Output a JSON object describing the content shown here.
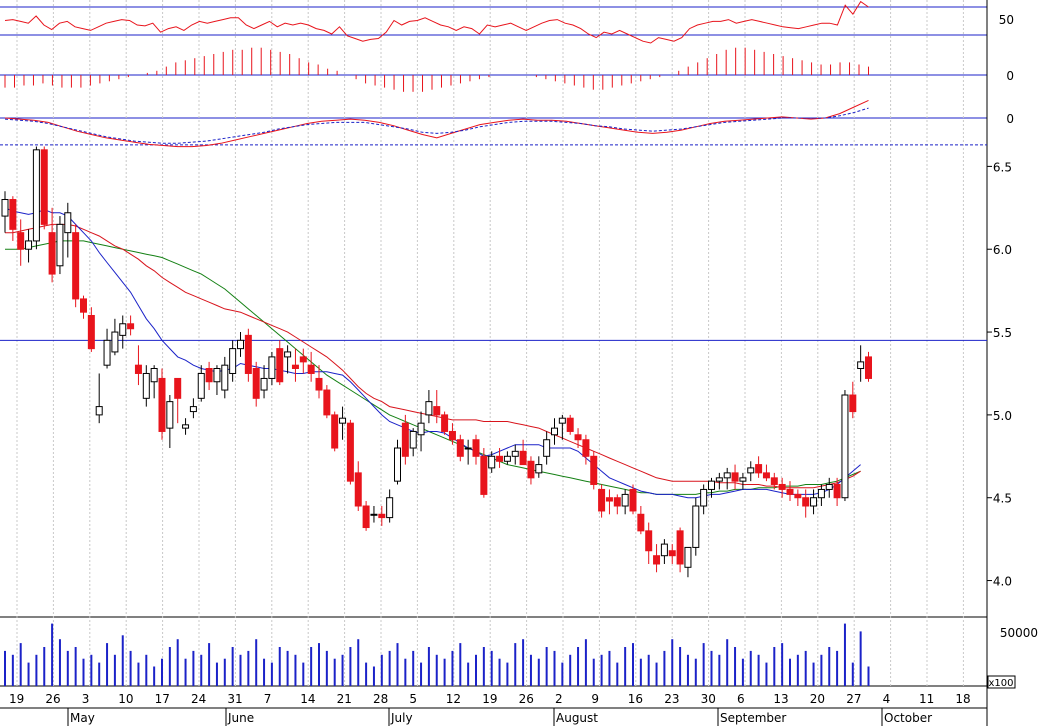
{
  "chart_data": {
    "type": "candlestick",
    "panels": {
      "rsi": {
        "ticks": [
          "50"
        ]
      },
      "histogram": {
        "ticks": [
          "0"
        ]
      },
      "macd": {
        "ticks": [
          "0"
        ]
      },
      "price": {
        "ylim": [
          3.78,
          6.78
        ],
        "ticks": [
          "6.5",
          "6.0",
          "5.5",
          "5.0",
          "4.5",
          "4.0"
        ],
        "dashed_level": 6.63,
        "solid_level": 5.45
      },
      "volume": {
        "ticks": [
          "50000"
        ],
        "multiplier": "x100"
      }
    },
    "x_day_labels": [
      "19",
      "26",
      "3",
      "10",
      "17",
      "24",
      "31",
      "7",
      "14",
      "21",
      "28",
      "5",
      "12",
      "19",
      "26",
      "2",
      "9",
      "16",
      "23",
      "30",
      "6",
      "13",
      "20",
      "27",
      "4",
      "11",
      "18"
    ],
    "x_month_labels": [
      "May",
      "June",
      "July",
      "August",
      "September",
      "October"
    ],
    "colors": {
      "up": "#ffffff",
      "down": "#e8141c",
      "ma_short": "#1b22c8",
      "ma_mid": "#d8141c",
      "ma_long": "#148014",
      "volume": "#1b22c8"
    },
    "ohlc": [
      [
        6.2,
        6.35,
        6.1,
        6.3
      ],
      [
        6.3,
        6.32,
        6.05,
        6.12
      ],
      [
        6.1,
        6.18,
        5.9,
        6.0
      ],
      [
        6.0,
        6.12,
        5.92,
        6.05
      ],
      [
        6.05,
        6.62,
        6.0,
        6.6
      ],
      [
        6.6,
        6.62,
        6.12,
        6.15
      ],
      [
        6.1,
        6.25,
        5.8,
        5.85
      ],
      [
        5.9,
        6.2,
        5.85,
        6.15
      ],
      [
        6.1,
        6.28,
        5.95,
        6.22
      ],
      [
        6.1,
        6.15,
        5.65,
        5.7
      ],
      [
        5.7,
        5.72,
        5.58,
        5.62
      ],
      [
        5.6,
        5.65,
        5.38,
        5.4
      ],
      [
        5.0,
        5.25,
        4.95,
        5.05
      ],
      [
        5.3,
        5.52,
        5.28,
        5.45
      ],
      [
        5.38,
        5.58,
        5.36,
        5.5
      ],
      [
        5.48,
        5.6,
        5.4,
        5.55
      ],
      [
        5.55,
        5.6,
        5.48,
        5.52
      ],
      [
        5.3,
        5.42,
        5.18,
        5.25
      ],
      [
        5.1,
        5.3,
        5.05,
        5.25
      ],
      [
        5.2,
        5.3,
        5.1,
        5.28
      ],
      [
        5.22,
        5.28,
        4.85,
        4.9
      ],
      [
        4.92,
        5.12,
        4.8,
        5.08
      ],
      [
        5.22,
        5.2,
        4.95,
        5.1
      ],
      [
        4.92,
        4.98,
        4.88,
        4.94
      ],
      [
        5.02,
        5.1,
        4.98,
        5.05
      ],
      [
        5.1,
        5.3,
        5.08,
        5.25
      ],
      [
        5.28,
        5.32,
        5.15,
        5.2
      ],
      [
        5.2,
        5.3,
        5.12,
        5.28
      ],
      [
        5.15,
        5.35,
        5.1,
        5.3
      ],
      [
        5.25,
        5.45,
        5.2,
        5.4
      ],
      [
        5.4,
        5.5,
        5.35,
        5.45
      ],
      [
        5.48,
        5.52,
        5.2,
        5.25
      ],
      [
        5.28,
        5.32,
        5.05,
        5.1
      ],
      [
        5.15,
        5.3,
        5.1,
        5.22
      ],
      [
        5.22,
        5.38,
        5.18,
        5.35
      ],
      [
        5.4,
        5.45,
        5.18,
        5.2
      ],
      [
        5.35,
        5.42,
        5.25,
        5.38
      ],
      [
        5.3,
        5.4,
        5.2,
        5.28
      ],
      [
        5.35,
        5.4,
        5.25,
        5.32
      ],
      [
        5.3,
        5.38,
        5.2,
        5.25
      ],
      [
        5.22,
        5.3,
        5.1,
        5.15
      ],
      [
        5.15,
        5.18,
        4.98,
        5.0
      ],
      [
        5.0,
        5.02,
        4.78,
        4.8
      ],
      [
        4.95,
        5.05,
        4.85,
        4.98
      ],
      [
        4.95,
        4.97,
        4.58,
        4.6
      ],
      [
        4.65,
        4.72,
        4.42,
        4.45
      ],
      [
        4.45,
        4.48,
        4.3,
        4.32
      ],
      [
        4.4,
        4.45,
        4.35,
        4.4
      ],
      [
        4.4,
        4.45,
        4.33,
        4.38
      ],
      [
        4.38,
        4.55,
        4.35,
        4.5
      ],
      [
        4.6,
        4.85,
        4.58,
        4.8
      ],
      [
        4.95,
        5.0,
        4.7,
        4.75
      ],
      [
        4.8,
        4.92,
        4.75,
        4.9
      ],
      [
        4.88,
        5.02,
        4.78,
        4.95
      ],
      [
        5.0,
        5.15,
        4.95,
        5.08
      ],
      [
        5.05,
        5.15,
        4.95,
        5.0
      ],
      [
        5.0,
        5.02,
        4.88,
        4.9
      ],
      [
        4.9,
        4.95,
        4.82,
        4.85
      ],
      [
        4.85,
        4.88,
        4.72,
        4.75
      ],
      [
        4.8,
        4.85,
        4.7,
        4.8
      ],
      [
        4.85,
        4.88,
        4.7,
        4.75
      ],
      [
        4.75,
        4.8,
        4.5,
        4.52
      ],
      [
        4.68,
        4.78,
        4.65,
        4.75
      ],
      [
        4.75,
        4.8,
        4.68,
        4.72
      ],
      [
        4.72,
        4.78,
        4.7,
        4.75
      ],
      [
        4.75,
        4.82,
        4.7,
        4.78
      ],
      [
        4.78,
        4.85,
        4.72,
        4.7
      ],
      [
        4.72,
        4.75,
        4.58,
        4.62
      ],
      [
        4.65,
        4.75,
        4.62,
        4.7
      ],
      [
        4.75,
        4.9,
        4.7,
        4.85
      ],
      [
        4.88,
        4.98,
        4.82,
        4.92
      ],
      [
        4.95,
        5.0,
        4.85,
        4.98
      ],
      [
        4.98,
        5.0,
        4.88,
        4.9
      ],
      [
        4.88,
        4.92,
        4.8,
        4.85
      ],
      [
        4.85,
        4.88,
        4.7,
        4.75
      ],
      [
        4.75,
        4.78,
        4.55,
        4.58
      ],
      [
        4.55,
        4.58,
        4.38,
        4.42
      ],
      [
        4.5,
        4.55,
        4.4,
        4.48
      ],
      [
        4.5,
        4.52,
        4.4,
        4.45
      ],
      [
        4.45,
        4.55,
        4.4,
        4.52
      ],
      [
        4.55,
        4.58,
        4.4,
        4.42
      ],
      [
        4.4,
        4.45,
        4.28,
        4.3
      ],
      [
        4.3,
        4.35,
        4.1,
        4.18
      ],
      [
        4.15,
        4.22,
        4.05,
        4.1
      ],
      [
        4.15,
        4.25,
        4.1,
        4.22
      ],
      [
        4.18,
        4.22,
        4.1,
        4.15
      ],
      [
        4.3,
        4.32,
        4.05,
        4.1
      ],
      [
        4.08,
        4.2,
        4.02,
        4.2
      ],
      [
        4.2,
        4.5,
        4.15,
        4.45
      ],
      [
        4.45,
        4.58,
        4.4,
        4.55
      ],
      [
        4.55,
        4.62,
        4.5,
        4.6
      ],
      [
        4.6,
        4.65,
        4.55,
        4.62
      ],
      [
        4.62,
        4.68,
        4.55,
        4.65
      ],
      [
        4.65,
        4.7,
        4.55,
        4.6
      ],
      [
        4.6,
        4.65,
        4.55,
        4.62
      ],
      [
        4.65,
        4.72,
        4.6,
        4.68
      ],
      [
        4.7,
        4.75,
        4.62,
        4.65
      ],
      [
        4.65,
        4.7,
        4.6,
        4.62
      ],
      [
        4.62,
        4.65,
        4.55,
        4.58
      ],
      [
        4.58,
        4.62,
        4.5,
        4.55
      ],
      [
        4.55,
        4.6,
        4.48,
        4.52
      ],
      [
        4.52,
        4.55,
        4.45,
        4.5
      ],
      [
        4.5,
        4.55,
        4.38,
        4.45
      ],
      [
        4.45,
        4.55,
        4.4,
        4.5
      ],
      [
        4.5,
        4.58,
        4.45,
        4.55
      ],
      [
        4.55,
        4.62,
        4.5,
        4.58
      ],
      [
        4.58,
        4.62,
        4.45,
        4.5
      ],
      [
        4.5,
        5.15,
        4.48,
        5.12
      ],
      [
        5.12,
        5.2,
        4.98,
        5.02
      ],
      [
        5.28,
        5.42,
        5.2,
        5.32
      ],
      [
        5.35,
        5.38,
        5.2,
        5.22
      ]
    ],
    "ma_short": [
      6.25,
      6.23,
      6.22,
      6.21,
      6.22,
      6.24,
      6.22,
      6.22,
      6.2,
      6.15,
      6.1,
      6.05,
      5.98,
      5.92,
      5.86,
      5.8,
      5.74,
      5.66,
      5.58,
      5.52,
      5.45,
      5.4,
      5.35,
      5.33,
      5.3,
      5.28,
      5.27,
      5.26,
      5.27,
      5.28,
      5.31,
      5.3,
      5.29,
      5.28,
      5.28,
      5.27,
      5.26,
      5.25,
      5.25,
      5.26,
      5.26,
      5.26,
      5.25,
      5.24,
      5.2,
      5.15,
      5.1,
      5.05,
      5.0,
      4.96,
      4.94,
      4.92,
      4.9,
      4.89,
      4.9,
      4.9,
      4.89,
      4.86,
      4.83,
      4.8,
      4.78,
      4.75,
      4.76,
      4.78,
      4.8,
      4.82,
      4.82,
      4.82,
      4.82,
      4.8,
      4.8,
      4.8,
      4.8,
      4.78,
      4.74,
      4.7,
      4.66,
      4.62,
      4.6,
      4.58,
      4.56,
      4.54,
      4.53,
      4.52,
      4.52,
      4.52,
      4.51,
      4.5,
      4.5,
      4.51,
      4.52,
      4.52,
      4.53,
      4.54,
      4.55,
      4.55,
      4.55,
      4.55,
      4.54,
      4.53,
      4.52,
      4.52,
      4.52,
      4.52,
      4.53,
      4.55,
      4.58,
      4.62,
      4.66,
      4.7
    ],
    "ma_mid": [
      6.1,
      6.1,
      6.11,
      6.12,
      6.13,
      6.14,
      6.15,
      6.15,
      6.15,
      6.14,
      6.12,
      6.1,
      6.08,
      6.05,
      6.02,
      6.0,
      5.97,
      5.94,
      5.9,
      5.87,
      5.83,
      5.8,
      5.77,
      5.74,
      5.72,
      5.7,
      5.68,
      5.66,
      5.64,
      5.63,
      5.62,
      5.6,
      5.58,
      5.56,
      5.54,
      5.52,
      5.5,
      5.47,
      5.44,
      5.41,
      5.38,
      5.35,
      5.31,
      5.27,
      5.22,
      5.17,
      5.13,
      5.1,
      5.08,
      5.05,
      5.04,
      5.03,
      5.02,
      5.01,
      5.0,
      4.99,
      4.98,
      4.97,
      4.97,
      4.97,
      4.97,
      4.96,
      4.96,
      4.96,
      4.96,
      4.95,
      4.94,
      4.93,
      4.92,
      4.9,
      4.88,
      4.86,
      4.84,
      4.82,
      4.8,
      4.78,
      4.76,
      4.74,
      4.72,
      4.7,
      4.68,
      4.66,
      4.64,
      4.62,
      4.61,
      4.6,
      4.6,
      4.6,
      4.6,
      4.6,
      4.6,
      4.59,
      4.59,
      4.59,
      4.58,
      4.58,
      4.58,
      4.57,
      4.57,
      4.56,
      4.56,
      4.56,
      4.56,
      4.56,
      4.57,
      4.58,
      4.59,
      4.61,
      4.63,
      4.66
    ],
    "ma_long": [
      6.0,
      6.0,
      6.0,
      6.01,
      6.02,
      6.03,
      6.04,
      6.05,
      6.05,
      6.05,
      6.05,
      6.04,
      6.03,
      6.02,
      6.01,
      6.0,
      5.99,
      5.98,
      5.97,
      5.96,
      5.95,
      5.93,
      5.91,
      5.89,
      5.87,
      5.85,
      5.82,
      5.79,
      5.76,
      5.72,
      5.68,
      5.64,
      5.6,
      5.56,
      5.52,
      5.48,
      5.44,
      5.4,
      5.36,
      5.32,
      5.28,
      5.24,
      5.21,
      5.18,
      5.15,
      5.12,
      5.09,
      5.06,
      5.03,
      5.0,
      4.98,
      4.96,
      4.94,
      4.92,
      4.9,
      4.88,
      4.86,
      4.84,
      4.82,
      4.8,
      4.78,
      4.76,
      4.74,
      4.72,
      4.7,
      4.69,
      4.68,
      4.67,
      4.66,
      4.65,
      4.64,
      4.63,
      4.62,
      4.61,
      4.6,
      4.59,
      4.58,
      4.57,
      4.56,
      4.55,
      4.54,
      4.53,
      4.53,
      4.52,
      4.52,
      4.52,
      4.52,
      4.52,
      4.52,
      4.53,
      4.53,
      4.54,
      4.54,
      4.55,
      4.55,
      4.55,
      4.56,
      4.56,
      4.56,
      4.57,
      4.57,
      4.57,
      4.58,
      4.58,
      4.58,
      4.59,
      4.6,
      4.62,
      4.64,
      4.66
    ],
    "rsi": [
      55,
      56,
      54,
      52,
      60,
      50,
      45,
      52,
      54,
      48,
      46,
      44,
      48,
      52,
      54,
      56,
      55,
      50,
      49,
      52,
      42,
      46,
      48,
      44,
      50,
      54,
      52,
      54,
      56,
      58,
      58,
      50,
      46,
      50,
      54,
      48,
      52,
      50,
      52,
      50,
      46,
      44,
      40,
      48,
      38,
      35,
      32,
      34,
      35,
      42,
      55,
      50,
      54,
      55,
      58,
      54,
      50,
      48,
      44,
      48,
      46,
      40,
      50,
      48,
      50,
      52,
      48,
      44,
      48,
      52,
      55,
      56,
      52,
      50,
      46,
      40,
      36,
      42,
      40,
      44,
      40,
      36,
      32,
      30,
      36,
      34,
      32,
      36,
      46,
      50,
      52,
      54,
      54,
      56,
      52,
      54,
      56,
      54,
      52,
      50,
      48,
      47,
      46,
      48,
      50,
      52,
      52,
      50,
      72,
      62,
      76,
      70
    ],
    "histogram": [
      -0.06,
      -0.06,
      -0.05,
      -0.05,
      -0.04,
      -0.05,
      -0.06,
      -0.06,
      -0.06,
      -0.05,
      -0.04,
      -0.03,
      -0.02,
      -0.01,
      0.0,
      0.01,
      0.02,
      0.04,
      0.06,
      0.07,
      0.08,
      0.09,
      0.1,
      0.11,
      0.12,
      0.12,
      0.13,
      0.13,
      0.12,
      0.11,
      0.1,
      0.08,
      0.06,
      0.05,
      0.03,
      0.02,
      0.0,
      -0.02,
      -0.04,
      -0.05,
      -0.06,
      -0.07,
      -0.08,
      -0.08,
      -0.08,
      -0.07,
      -0.06,
      -0.05,
      -0.04,
      -0.03,
      -0.02,
      -0.01,
      0.0,
      0.0,
      0.0,
      0.0,
      -0.01,
      -0.02,
      -0.03,
      -0.04,
      -0.05,
      -0.06,
      -0.07,
      -0.07,
      -0.06,
      -0.05,
      -0.04,
      -0.03,
      -0.02,
      -0.01,
      0.0,
      0.02,
      0.04,
      0.06,
      0.08,
      0.1,
      0.12,
      0.13,
      0.13,
      0.12,
      0.11,
      0.1,
      0.09,
      0.08,
      0.07,
      0.06,
      0.05,
      0.05,
      0.06,
      0.06,
      0.05,
      0.04
    ],
    "macd_line": [
      0.0,
      -0.01,
      -0.02,
      -0.04,
      -0.08,
      -0.12,
      -0.15,
      -0.18,
      -0.2,
      -0.22,
      -0.24,
      -0.25,
      -0.26,
      -0.26,
      -0.25,
      -0.23,
      -0.2,
      -0.17,
      -0.14,
      -0.11,
      -0.08,
      -0.05,
      -0.03,
      -0.02,
      -0.01,
      -0.02,
      -0.04,
      -0.07,
      -0.11,
      -0.15,
      -0.18,
      -0.14,
      -0.1,
      -0.06,
      -0.04,
      -0.02,
      -0.01,
      -0.02,
      -0.02,
      -0.03,
      -0.05,
      -0.07,
      -0.09,
      -0.11,
      -0.13,
      -0.14,
      -0.13,
      -0.11,
      -0.08,
      -0.05,
      -0.03,
      -0.02,
      -0.01,
      0.0,
      0.01,
      0.0,
      -0.01,
      0.0,
      0.04,
      0.1,
      0.16
    ],
    "macd_signal": [
      -0.01,
      -0.02,
      -0.03,
      -0.05,
      -0.08,
      -0.11,
      -0.14,
      -0.17,
      -0.19,
      -0.21,
      -0.22,
      -0.23,
      -0.23,
      -0.22,
      -0.21,
      -0.19,
      -0.17,
      -0.15,
      -0.13,
      -0.1,
      -0.08,
      -0.06,
      -0.05,
      -0.04,
      -0.04,
      -0.04,
      -0.06,
      -0.08,
      -0.1,
      -0.13,
      -0.14,
      -0.13,
      -0.11,
      -0.08,
      -0.06,
      -0.04,
      -0.03,
      -0.03,
      -0.03,
      -0.04,
      -0.05,
      -0.07,
      -0.08,
      -0.1,
      -0.11,
      -0.12,
      -0.11,
      -0.1,
      -0.08,
      -0.06,
      -0.04,
      -0.03,
      -0.02,
      -0.01,
      0.0,
      0.0,
      0.0,
      0.0,
      0.02,
      0.05,
      0.09
    ],
    "volume": [
      9,
      8,
      11,
      6,
      8,
      10,
      16,
      12,
      9,
      10,
      7,
      8,
      6,
      11,
      8,
      13,
      9,
      6,
      8,
      5,
      7,
      10,
      12,
      7,
      9,
      8,
      11,
      6,
      7,
      10,
      8,
      9,
      12,
      7,
      6,
      10,
      9,
      8,
      6,
      10,
      11,
      9,
      7,
      8,
      10,
      12,
      6,
      5,
      8,
      9,
      11,
      7,
      9,
      6,
      10,
      8,
      7,
      9,
      11,
      6,
      8,
      10,
      9,
      7,
      6,
      11,
      12,
      8,
      7,
      10,
      9,
      6,
      8,
      10,
      12,
      7,
      8,
      9,
      6,
      10,
      11,
      7,
      8,
      6,
      9,
      12,
      10,
      8,
      7,
      11,
      9,
      8,
      12,
      10,
      7,
      9,
      8,
      6,
      10,
      11,
      7,
      8,
      9,
      6,
      8,
      10,
      9,
      16,
      6,
      14,
      5
    ]
  }
}
